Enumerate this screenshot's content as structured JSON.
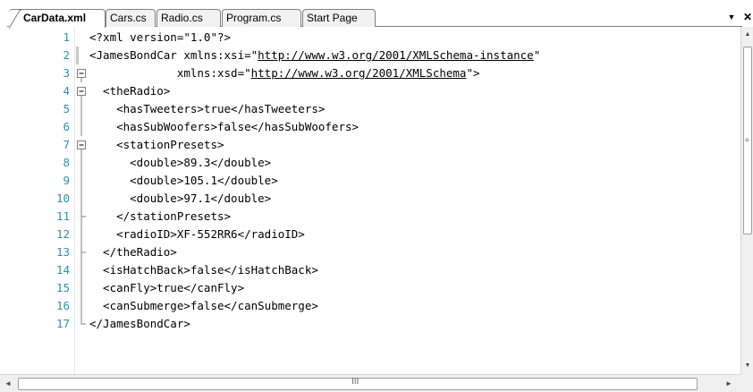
{
  "tabs": [
    {
      "label": "CarData.xml",
      "active": true
    },
    {
      "label": "Cars.cs",
      "active": false
    },
    {
      "label": "Radio.cs",
      "active": false
    },
    {
      "label": "Program.cs",
      "active": false
    },
    {
      "label": "Start Page",
      "active": false
    }
  ],
  "window_controls": {
    "dropdown": "▼",
    "close": "✕"
  },
  "scrollbars": {
    "up": "▲",
    "down": "▼",
    "left": "◄",
    "right": "►",
    "vgrip": "≡",
    "hgrip": "III"
  },
  "editor": {
    "fold_color": "#808080",
    "lines": [
      {
        "num": "1",
        "text": "<?xml version=\"1.0\"?>",
        "fold": "none"
      },
      {
        "num": "2",
        "text": "<JamesBondCar xmlns:xsi=\"",
        "link": "http://www.w3.org/2001/XMLSchema-instance",
        "tail": "\"",
        "fold": "bar"
      },
      {
        "num": "3",
        "text": "             xmlns:xsd=\"",
        "link": "http://www.w3.org/2001/XMLSchema",
        "tail": "\">",
        "fold": "minus"
      },
      {
        "num": "4",
        "text": "  <theRadio>",
        "fold": "minus"
      },
      {
        "num": "5",
        "text": "    <hasTweeters>true</hasTweeters>",
        "fold": "line"
      },
      {
        "num": "6",
        "text": "    <hasSubWoofers>false</hasSubWoofers>",
        "fold": "line"
      },
      {
        "num": "7",
        "text": "    <stationPresets>",
        "fold": "minus"
      },
      {
        "num": "8",
        "text": "      <double>89.3</double>",
        "fold": "line"
      },
      {
        "num": "9",
        "text": "      <double>105.1</double>",
        "fold": "line"
      },
      {
        "num": "10",
        "text": "      <double>97.1</double>",
        "fold": "line"
      },
      {
        "num": "11",
        "text": "    </stationPresets>",
        "fold": "end"
      },
      {
        "num": "12",
        "text": "    <radioID>XF-552RR6</radioID>",
        "fold": "line"
      },
      {
        "num": "13",
        "text": "  </theRadio>",
        "fold": "end"
      },
      {
        "num": "14",
        "text": "  <isHatchBack>false</isHatchBack>",
        "fold": "line"
      },
      {
        "num": "15",
        "text": "  <canFly>true</canFly>",
        "fold": "line"
      },
      {
        "num": "16",
        "text": "  <canSubmerge>false</canSubmerge>",
        "fold": "line"
      },
      {
        "num": "17",
        "text": "</JamesBondCar>",
        "fold": "last"
      }
    ]
  }
}
